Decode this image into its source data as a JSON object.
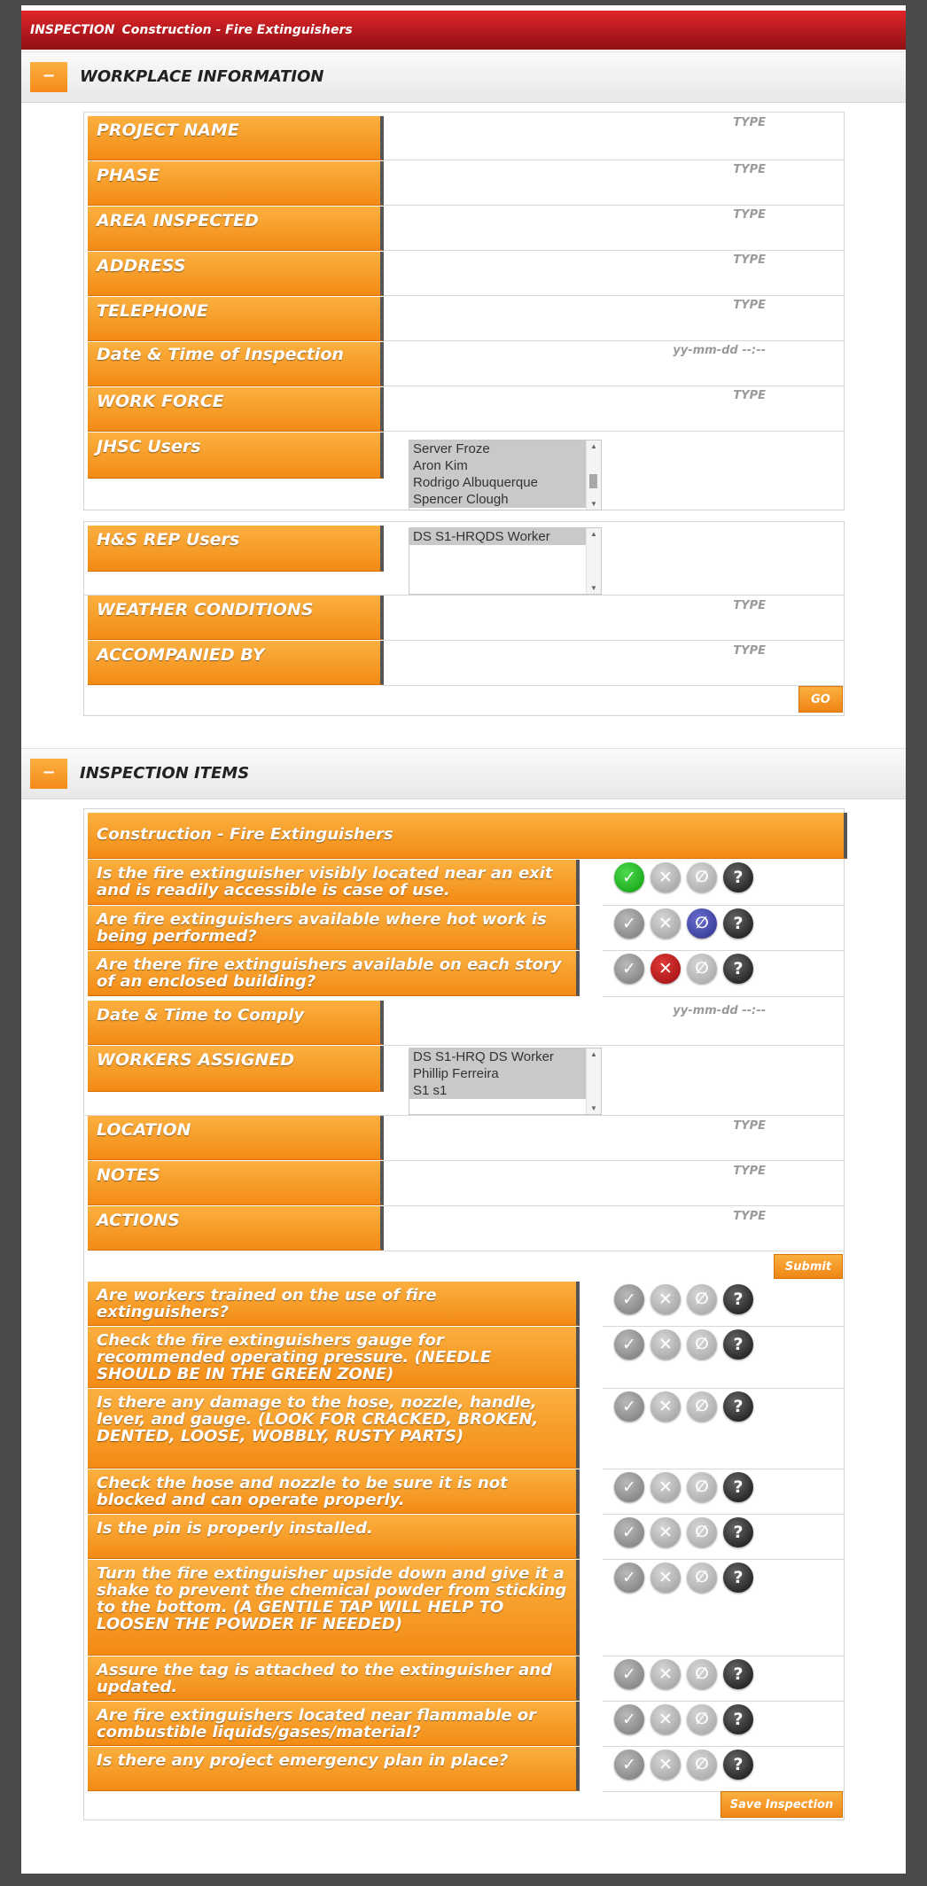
{
  "title": {
    "prefix": "INSPECTION",
    "name": "Construction - Fire Extinguishers"
  },
  "workplace": {
    "toggle": "−",
    "heading": "WORKPLACE INFORMATION",
    "fields": [
      {
        "label": "PROJECT NAME",
        "placeholder": "TYPE"
      },
      {
        "label": "PHASE",
        "placeholder": "TYPE"
      },
      {
        "label": "AREA INSPECTED",
        "placeholder": "TYPE"
      },
      {
        "label": "ADDRESS",
        "placeholder": "TYPE"
      },
      {
        "label": "TELEPHONE",
        "placeholder": "TYPE"
      },
      {
        "label": "Date & Time of Inspection",
        "placeholder": "yy-mm-dd --:--"
      },
      {
        "label": "WORK FORCE",
        "placeholder": "TYPE"
      }
    ],
    "jhsc": {
      "label": "JHSC Users",
      "options": [
        "Server Froze",
        "Aron Kim",
        "Rodrigo Albuquerque",
        "Spencer Clough"
      ]
    },
    "hs_rep": {
      "label": "H&S REP Users",
      "options": [
        "DS S1-HRQDS Worker"
      ]
    },
    "weather": {
      "label": "WEATHER CONDITIONS",
      "placeholder": "TYPE"
    },
    "accompanied": {
      "label": "ACCOMPANIED BY",
      "placeholder": "TYPE"
    },
    "go_button": "GO"
  },
  "inspection": {
    "toggle": "−",
    "heading": "INSPECTION ITEMS",
    "group_title": "Construction - Fire Extinguishers",
    "icon_glyphs": {
      "ok": "✓",
      "no": "✕",
      "na": "∅",
      "q": "?"
    },
    "items_top": [
      {
        "text": "Is the fire extinguisher visibly located near an exit and is readily accessible is case of use.",
        "state": "ok"
      },
      {
        "text": "Are fire extinguishers available where hot work is being performed?",
        "state": "na"
      },
      {
        "text": "Are there fire extinguishers available on each story of an enclosed building?",
        "state": "no"
      }
    ],
    "comply": {
      "label": "Date & Time to Comply",
      "placeholder": "yy-mm-dd --:--"
    },
    "workers": {
      "label": "WORKERS ASSIGNED",
      "options": [
        "DS S1-HRQ DS Worker",
        "Phillip Ferreira",
        "S1 s1"
      ]
    },
    "location": {
      "label": "LOCATION",
      "placeholder": "TYPE"
    },
    "notes": {
      "label": "NOTES",
      "placeholder": "TYPE"
    },
    "actions": {
      "label": "ACTIONS",
      "placeholder": "TYPE"
    },
    "submit_button": "Submit",
    "items_bottom": [
      {
        "text": "Are workers trained on the use of fire extinguishers?",
        "state": "none"
      },
      {
        "text": "Check the fire extinguishers gauge for recommended operating pressure. (NEEDLE SHOULD BE IN THE GREEN ZONE)",
        "state": "none"
      },
      {
        "text": "Is there any damage to the hose, nozzle, handle, lever, and gauge. (LOOK FOR CRACKED, BROKEN, DENTED, LOOSE, WOBBLY, RUSTY PARTS)",
        "state": "none"
      },
      {
        "text": "Check the hose and nozzle to be sure it is not blocked and can operate properly.",
        "state": "none"
      },
      {
        "text": "Is the pin is properly installed.",
        "state": "none"
      },
      {
        "text": "Turn the fire extinguisher upside down and give it a shake to prevent the chemical powder from sticking to the bottom. (A GENTILE TAP WILL HELP TO LOOSEN THE POWDER IF NEEDED)",
        "state": "none"
      },
      {
        "text": "Assure the tag is attached to the extinguisher and updated.",
        "state": "none"
      },
      {
        "text": "Are fire extinguishers located near flammable or combustible liquids/gases/material?",
        "state": "none"
      },
      {
        "text": "Is there any project emergency plan in place?",
        "state": "none"
      }
    ],
    "save_button": "Save Inspection"
  }
}
